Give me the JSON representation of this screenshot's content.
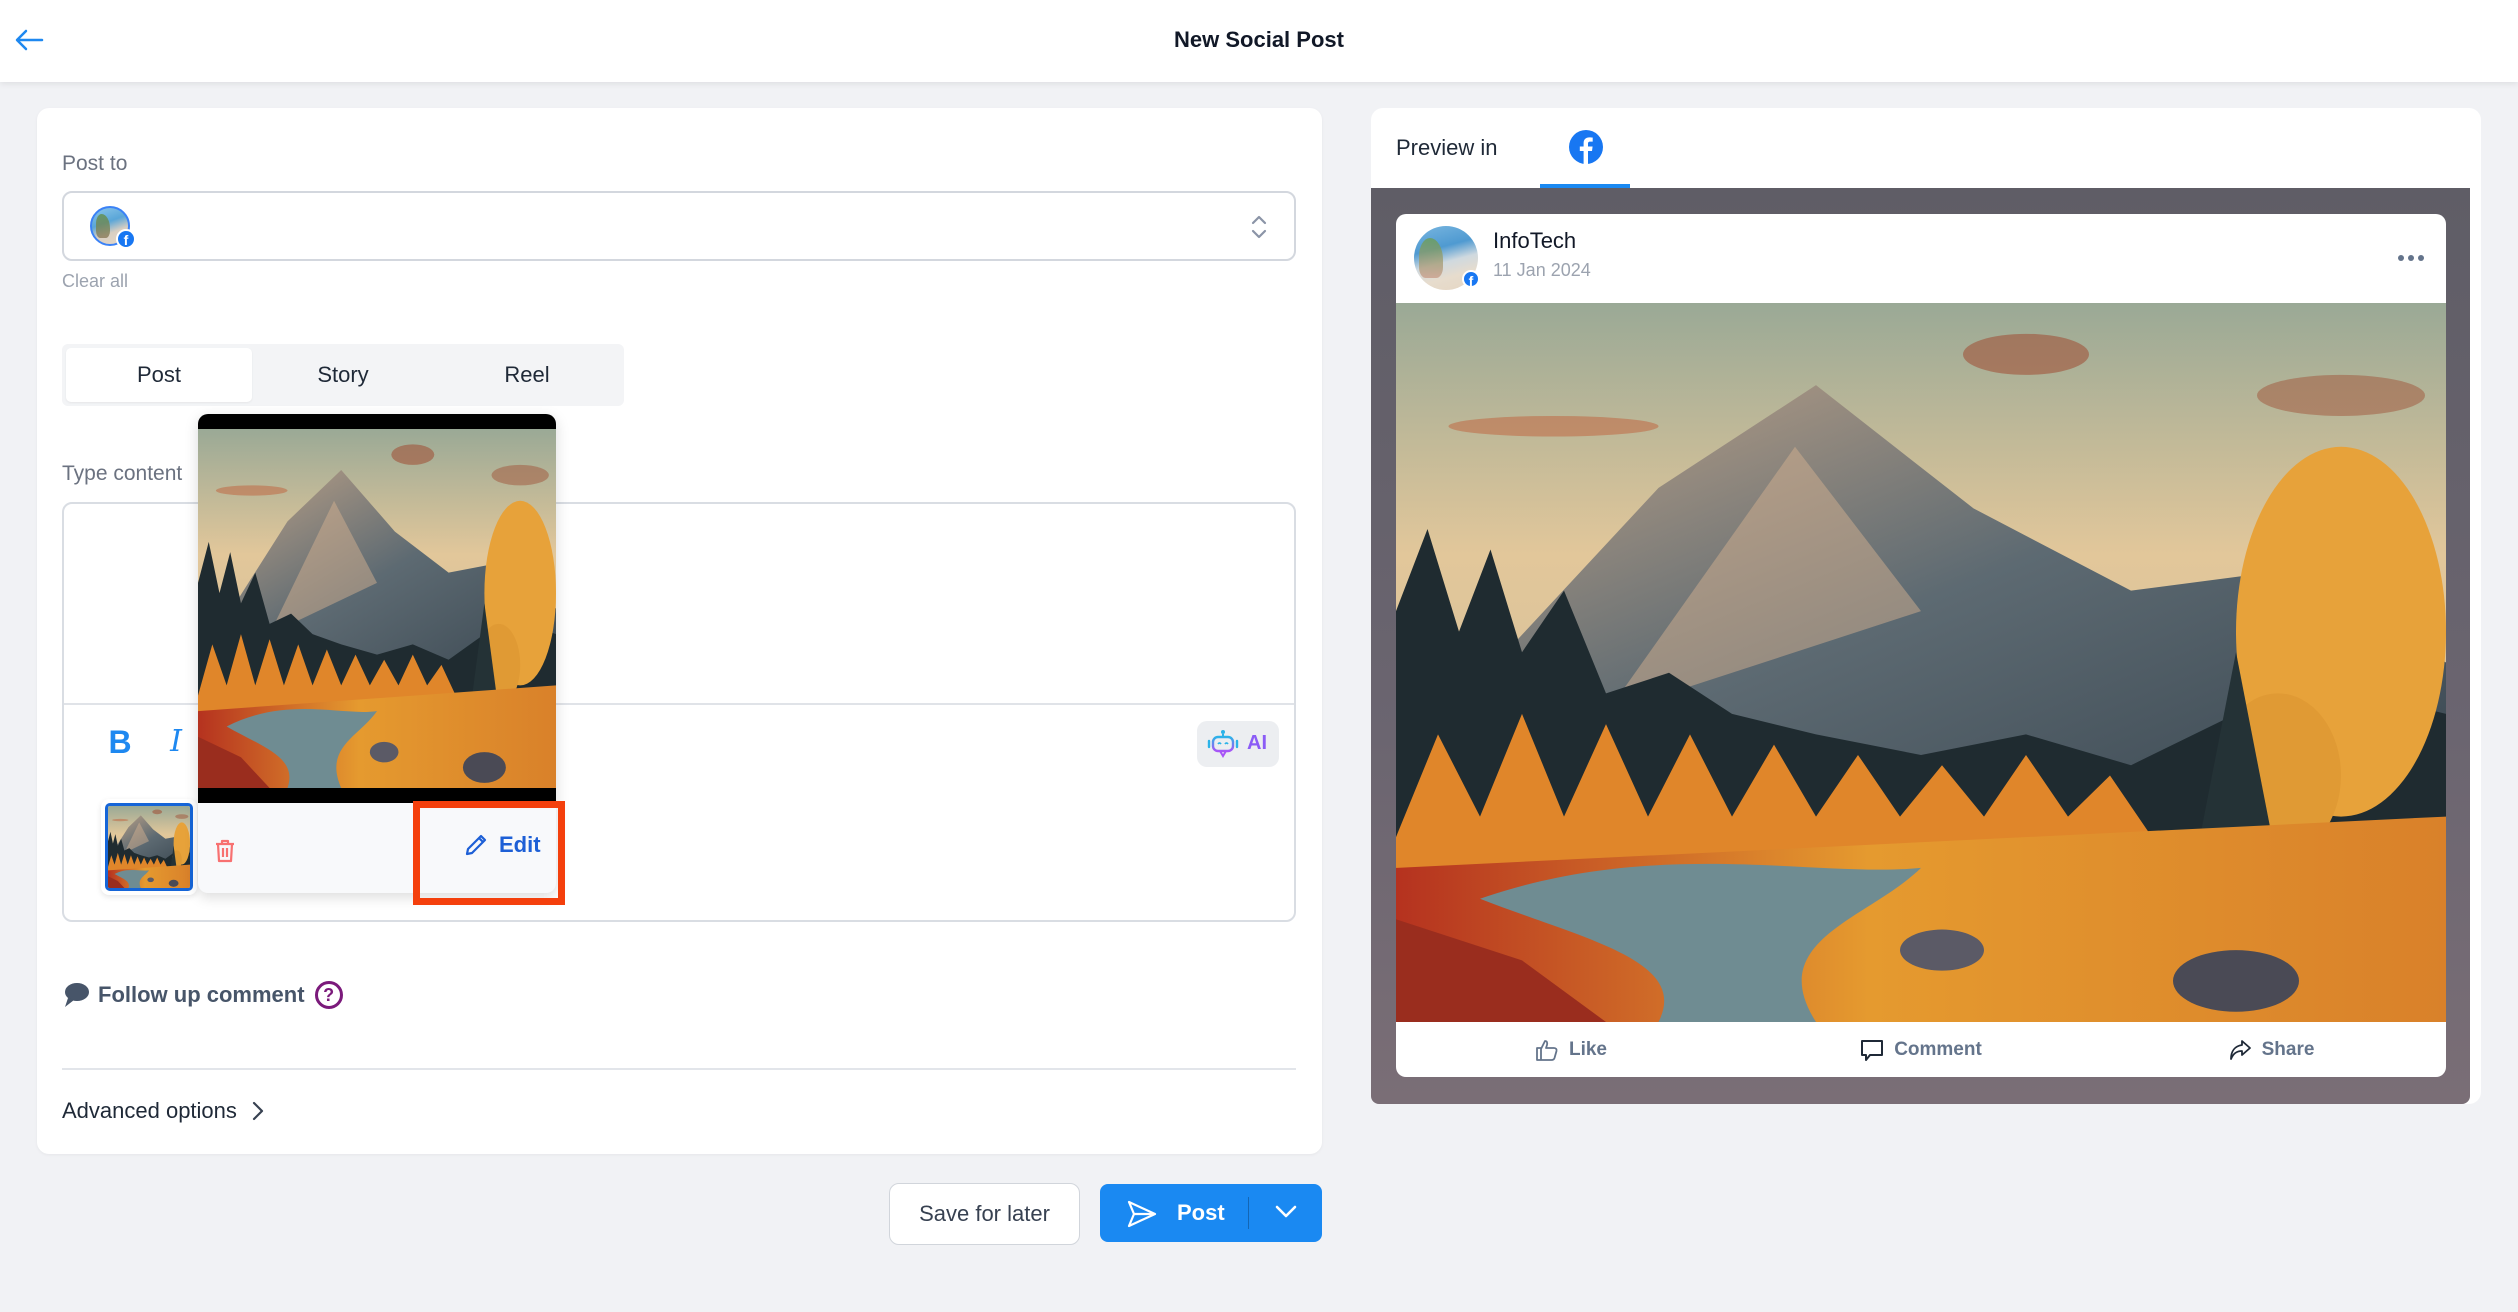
{
  "header": {
    "title": "New Social Post",
    "back_icon": "arrow-left-icon"
  },
  "composer": {
    "post_to_label": "Post to",
    "selected_accounts": [
      {
        "name": "InfoTech",
        "network": "facebook"
      }
    ],
    "clear_all_label": "Clear all",
    "post_types": [
      {
        "label": "Post",
        "active": true
      },
      {
        "label": "Story",
        "active": false
      },
      {
        "label": "Reel",
        "active": false
      }
    ],
    "content_label": "Type content",
    "content_value": "",
    "format": {
      "bold_label": "B",
      "italic_label": "I",
      "ai_label": "AI"
    },
    "media_popover": {
      "delete_icon": "trash-icon",
      "edit_label": "Edit"
    },
    "follow_up_label": "Follow up comment",
    "help_label": "?",
    "advanced_label": "Advanced options"
  },
  "actions": {
    "save_label": "Save for later",
    "post_label": "Post"
  },
  "preview": {
    "label": "Preview in",
    "network_tab": "facebook",
    "post": {
      "account_name": "InfoTech",
      "date": "11 Jan 2024",
      "actions": [
        "Like",
        "Comment",
        "Share"
      ]
    }
  },
  "colors": {
    "accent": "#1a89f2",
    "facebook": "#1877f2",
    "highlight": "#f43f0c",
    "ai": "#8b5cf6",
    "help": "#7b1a7b"
  }
}
